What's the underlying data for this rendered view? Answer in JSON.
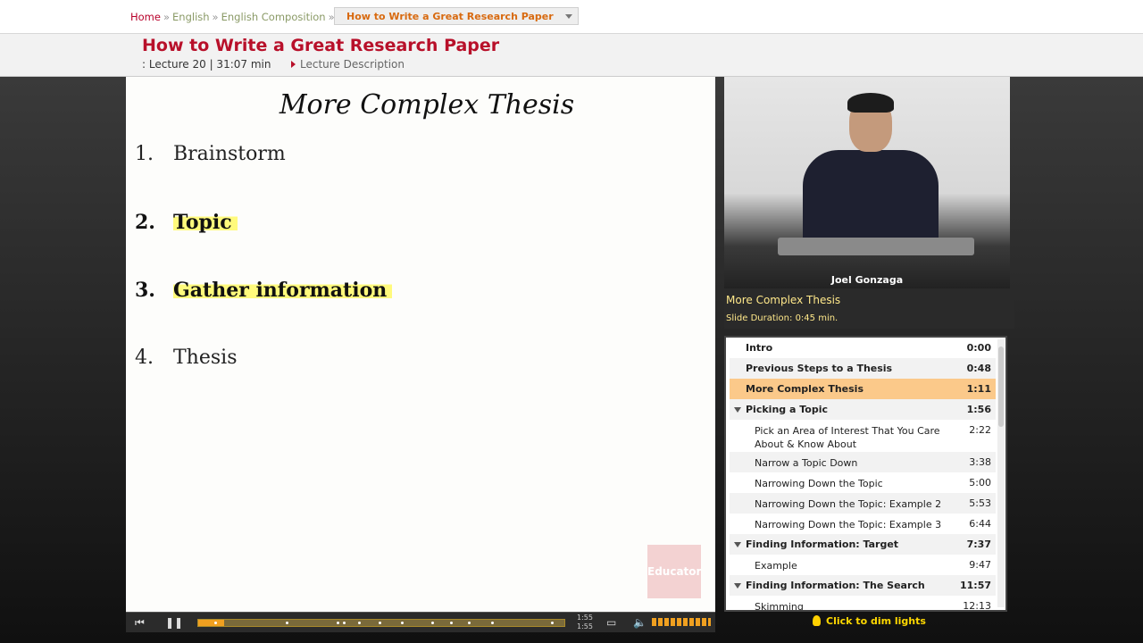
{
  "breadcrumb": {
    "home": "Home",
    "subject": "English",
    "course": "English Composition",
    "current": "How to Write a Great Research Paper",
    "separator": "»"
  },
  "header": {
    "title": "How to Write a Great Research Paper",
    "lecture_info": ": Lecture 20 | 31:07 min",
    "description_link": "Lecture Description"
  },
  "slide": {
    "title": "More Complex Thesis",
    "items": [
      {
        "num": "1.",
        "text": "Brainstorm"
      },
      {
        "num": "2.",
        "text": "Topic"
      },
      {
        "num": "3.",
        "text": "Gather information"
      },
      {
        "num": "4.",
        "text": "Thesis"
      }
    ],
    "watermark": "Educator"
  },
  "player": {
    "time_current": "1:55",
    "time_total": "1:55",
    "progress": 0.07
  },
  "video": {
    "presenter": "Joel Gonzaga"
  },
  "slide_info": {
    "name": "More Complex Thesis",
    "duration": "Slide Duration: 0:45 min."
  },
  "toc": [
    {
      "label": "Intro",
      "time": "0:00"
    },
    {
      "label": "Previous Steps to a Thesis",
      "time": "0:48"
    },
    {
      "label": "More Complex Thesis",
      "time": "1:11"
    },
    {
      "label": "Picking a Topic",
      "time": "1:56"
    },
    {
      "label": "Pick an Area of Interest That You Care About & Know About",
      "time": "2:22"
    },
    {
      "label": "Narrow a Topic Down",
      "time": "3:38"
    },
    {
      "label": "Narrowing Down the Topic",
      "time": "5:00"
    },
    {
      "label": "Narrowing Down the Topic: Example 2",
      "time": "5:53"
    },
    {
      "label": "Narrowing Down the Topic: Example 3",
      "time": "6:44"
    },
    {
      "label": "Finding Information: Target",
      "time": "7:37"
    },
    {
      "label": "Example",
      "time": "9:47"
    },
    {
      "label": "Finding Information: The Search",
      "time": "11:57"
    },
    {
      "label": "Skimming",
      "time": "12:13"
    }
  ],
  "dim_lights": "Click to dim lights",
  "colors": {
    "brand_red": "#b8102a",
    "accent_orange": "#f0a020",
    "active_row": "#fbc98a",
    "highlight": "#fffa6e"
  }
}
